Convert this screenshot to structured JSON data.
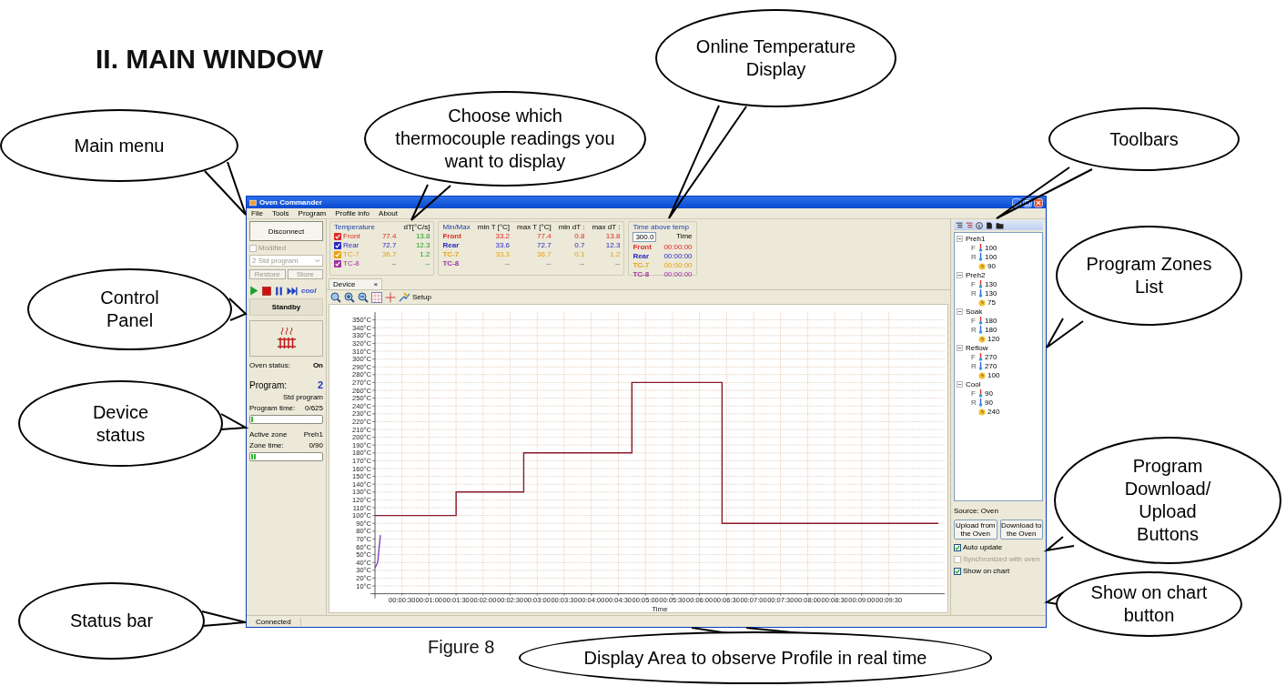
{
  "heading": "II. MAIN WINDOW",
  "callouts": [
    {
      "text": "Choose which thermocouple readings you want to display"
    },
    {
      "text": "Online Temperature Display"
    },
    {
      "text": "Main menu"
    },
    {
      "text": "Toolbars"
    },
    {
      "text": "Control Panel"
    },
    {
      "text": "Program Zones List"
    },
    {
      "text": "Device status"
    },
    {
      "text": "Program Download/ Upload Buttons"
    },
    {
      "text": "Status bar"
    },
    {
      "text": "Show on chart button"
    },
    {
      "text": "Display Area to observe Profile in real time"
    }
  ],
  "window": {
    "title": "Oven Commander",
    "menu": [
      "File",
      "Tools",
      "Program",
      "Profile info",
      "About"
    ],
    "control_panel": {
      "connect_button": "Disconnect",
      "modified": {
        "label": "Modified",
        "checked": false,
        "disabled": true
      },
      "program_select": {
        "value": "2 Std program",
        "disabled": true
      },
      "buttons": [
        {
          "label": "Restore",
          "disabled": true
        },
        {
          "label": "Store",
          "disabled": true
        }
      ],
      "cool_button": "cool",
      "state": "Standby"
    },
    "device_status": {
      "oven_status_label": "Oven status:",
      "oven_status": "On",
      "program_label": "Program:",
      "program_number": "2",
      "program_name": "Std program",
      "program_time_label": "Program time:",
      "program_time": "0/625",
      "program_progress": {
        "level": 0.03
      },
      "active_zone_label": "Active  zone",
      "active_zone": "Preh1",
      "zone_time_label": "Zone time:",
      "zone_time": "0/90",
      "zone_progress": {
        "level": 0.08
      }
    },
    "temperature": {
      "title": "Temperature",
      "dt_header": "dT[°C/s]",
      "rows": [
        {
          "label": "Front",
          "color": "#e02828",
          "checked": true,
          "value": "77.4",
          "dt": "13.8"
        },
        {
          "label": "Rear",
          "color": "#2828c8",
          "checked": true,
          "value": "72.7",
          "dt": "12.3"
        },
        {
          "label": "TC-7",
          "color": "#e8a010",
          "checked": true,
          "value": "36.7",
          "dt": "1.2"
        },
        {
          "label": "TC-8",
          "color": "#a030a0",
          "checked": true,
          "value": "--",
          "dt": "--"
        }
      ]
    },
    "min_max": {
      "title": "Min/Max",
      "headers": [
        "min T [°C]",
        "max T [°C]",
        "min dT :",
        "max dT :"
      ],
      "rows": [
        {
          "label": "Front",
          "color": "#e02828",
          "values": [
            "33.2",
            "77.4",
            "0.8",
            "13.8"
          ]
        },
        {
          "label": "Rear",
          "color": "#2828c8",
          "values": [
            "33.6",
            "72.7",
            "0.7",
            "12.3"
          ]
        },
        {
          "label": "TC-7",
          "color": "#e8a010",
          "values": [
            "33.3",
            "36.7",
            "0.1",
            "1.2"
          ]
        },
        {
          "label": "TC-8",
          "color": "#a030a0",
          "values": [
            "--",
            "--",
            "--",
            "--"
          ]
        }
      ]
    },
    "time_above": {
      "title": "Time above temp",
      "threshold": "300.0",
      "header": "Time",
      "rows": [
        {
          "label": "Front",
          "color": "#e02828",
          "time": "00:00:00"
        },
        {
          "label": "Rear",
          "color": "#2828c8",
          "time": "00:00:00"
        },
        {
          "label": "TC-7",
          "color": "#e8a010",
          "time": "00:00:00"
        },
        {
          "label": "TC-8",
          "color": "#a030a0",
          "time": "00:00:00"
        }
      ]
    },
    "tab": {
      "label": "Device",
      "close": "×"
    },
    "chart_toolbar": {
      "setup": "Setup"
    },
    "chart": {
      "chart_data": {
        "type": "line",
        "xlabel": "Time",
        "grid": true,
        "x": [
          0,
          3,
          6,
          90,
          90,
          165,
          165,
          285,
          285,
          385,
          385,
          625
        ],
        "series": [
          {
            "color": "#8b1a2a",
            "values": [
              100,
              100,
              100,
              100,
              130,
              130,
              180,
              180,
              270,
              270,
              90,
              90
            ]
          },
          {
            "color": "#8040c0",
            "values": [
              33,
              40,
              75,
              null,
              null,
              null,
              null,
              null,
              null,
              null,
              null,
              null
            ]
          }
        ],
        "xlim": [
          0,
          632
        ],
        "ylim": [
          0,
          360
        ],
        "xticks": [
          {
            "value": 30,
            "label": "00:00:30"
          },
          {
            "value": 60,
            "label": "00:01:00"
          },
          {
            "value": 90,
            "label": "00:01:30"
          },
          {
            "value": 120,
            "label": "00:02:00"
          },
          {
            "value": 150,
            "label": "00:02:30"
          },
          {
            "value": 180,
            "label": "00:03:00"
          },
          {
            "value": 210,
            "label": "00:03:30"
          },
          {
            "value": 240,
            "label": "00:04:00"
          },
          {
            "value": 270,
            "label": "00:04:30"
          },
          {
            "value": 300,
            "label": "00:05:00"
          },
          {
            "value": 330,
            "label": "00:05:30"
          },
          {
            "value": 360,
            "label": "00:06:00"
          },
          {
            "value": 390,
            "label": "00:06:30"
          },
          {
            "value": 420,
            "label": "00:07:00"
          },
          {
            "value": 450,
            "label": "00:07:30"
          },
          {
            "value": 480,
            "label": "00:08:00"
          },
          {
            "value": 510,
            "label": "00:08:30"
          },
          {
            "value": 540,
            "label": "00:09:00"
          },
          {
            "value": 570,
            "label": "00:09:30"
          }
        ],
        "yticks": [
          {
            "value": 10,
            "label": "10°C"
          },
          {
            "value": 20,
            "label": "20°C"
          },
          {
            "value": 30,
            "label": "30°C"
          },
          {
            "value": 40,
            "label": "40°C"
          },
          {
            "value": 50,
            "label": "50°C"
          },
          {
            "value": 60,
            "label": "60°C"
          },
          {
            "value": 70,
            "label": "70°C"
          },
          {
            "value": 80,
            "label": "80°C"
          },
          {
            "value": 90,
            "label": "90°C"
          },
          {
            "value": 100,
            "label": "100°C"
          },
          {
            "value": 110,
            "label": "110°C"
          },
          {
            "value": 120,
            "label": "120°C"
          },
          {
            "value": 130,
            "label": "130°C"
          },
          {
            "value": 140,
            "label": "140°C"
          },
          {
            "value": 150,
            "label": "150°C"
          },
          {
            "value": 160,
            "label": "160°C"
          },
          {
            "value": 170,
            "label": "170°C"
          },
          {
            "value": 180,
            "label": "180°C"
          },
          {
            "value": 190,
            "label": "190°C"
          },
          {
            "value": 200,
            "label": "200°C"
          },
          {
            "value": 210,
            "label": "210°C"
          },
          {
            "value": 220,
            "label": "220°C"
          },
          {
            "value": 230,
            "label": "230°C"
          },
          {
            "value": 240,
            "label": "240°C"
          },
          {
            "value": 250,
            "label": "250°C"
          },
          {
            "value": 260,
            "label": "260°C"
          },
          {
            "value": 270,
            "label": "270°C"
          },
          {
            "value": 280,
            "label": "280°C"
          },
          {
            "value": 290,
            "label": "290°C"
          },
          {
            "value": 300,
            "label": "300°C"
          },
          {
            "value": 310,
            "label": "310°C"
          },
          {
            "value": 320,
            "label": "320°C"
          },
          {
            "value": 330,
            "label": "330°C"
          },
          {
            "value": 340,
            "label": "340°C"
          },
          {
            "value": 350,
            "label": "350°C"
          }
        ]
      }
    },
    "zones": [
      {
        "name": "Preh1",
        "expanded": true,
        "children": [
          {
            "kind": "front",
            "label": "F",
            "value": "100"
          },
          {
            "kind": "rear",
            "label": "R",
            "value": "100"
          },
          {
            "kind": "time",
            "value": "90"
          }
        ]
      },
      {
        "name": "Preh2",
        "expanded": true,
        "children": [
          {
            "kind": "front",
            "label": "F",
            "value": "130"
          },
          {
            "kind": "rear",
            "label": "R",
            "value": "130"
          },
          {
            "kind": "time",
            "value": "75"
          }
        ]
      },
      {
        "name": "Soak",
        "expanded": true,
        "children": [
          {
            "kind": "front",
            "label": "F",
            "value": "180"
          },
          {
            "kind": "rear",
            "label": "R",
            "value": "180"
          },
          {
            "kind": "time",
            "value": "120"
          }
        ]
      },
      {
        "name": "Reflow",
        "expanded": true,
        "children": [
          {
            "kind": "front",
            "label": "F",
            "value": "270"
          },
          {
            "kind": "rear",
            "label": "R",
            "value": "270"
          },
          {
            "kind": "time",
            "value": "100"
          }
        ]
      },
      {
        "name": "Cool",
        "expanded": true,
        "children": [
          {
            "kind": "front",
            "label": "F",
            "value": "90"
          },
          {
            "kind": "rear",
            "label": "R",
            "value": "90"
          },
          {
            "kind": "time",
            "value": "240"
          }
        ]
      }
    ],
    "source": "Source: Oven",
    "transfer_buttons": [
      "Upload from the Oven",
      "Download to the Oven"
    ],
    "options": [
      {
        "label": "Auto update",
        "checked": true,
        "disabled": false
      },
      {
        "label": "Synchronized with oven",
        "checked": false,
        "disabled": true
      },
      {
        "label": "Show on chart",
        "checked": true,
        "disabled": false
      }
    ],
    "status_bar": "Connected"
  },
  "caption": "Figure 8"
}
